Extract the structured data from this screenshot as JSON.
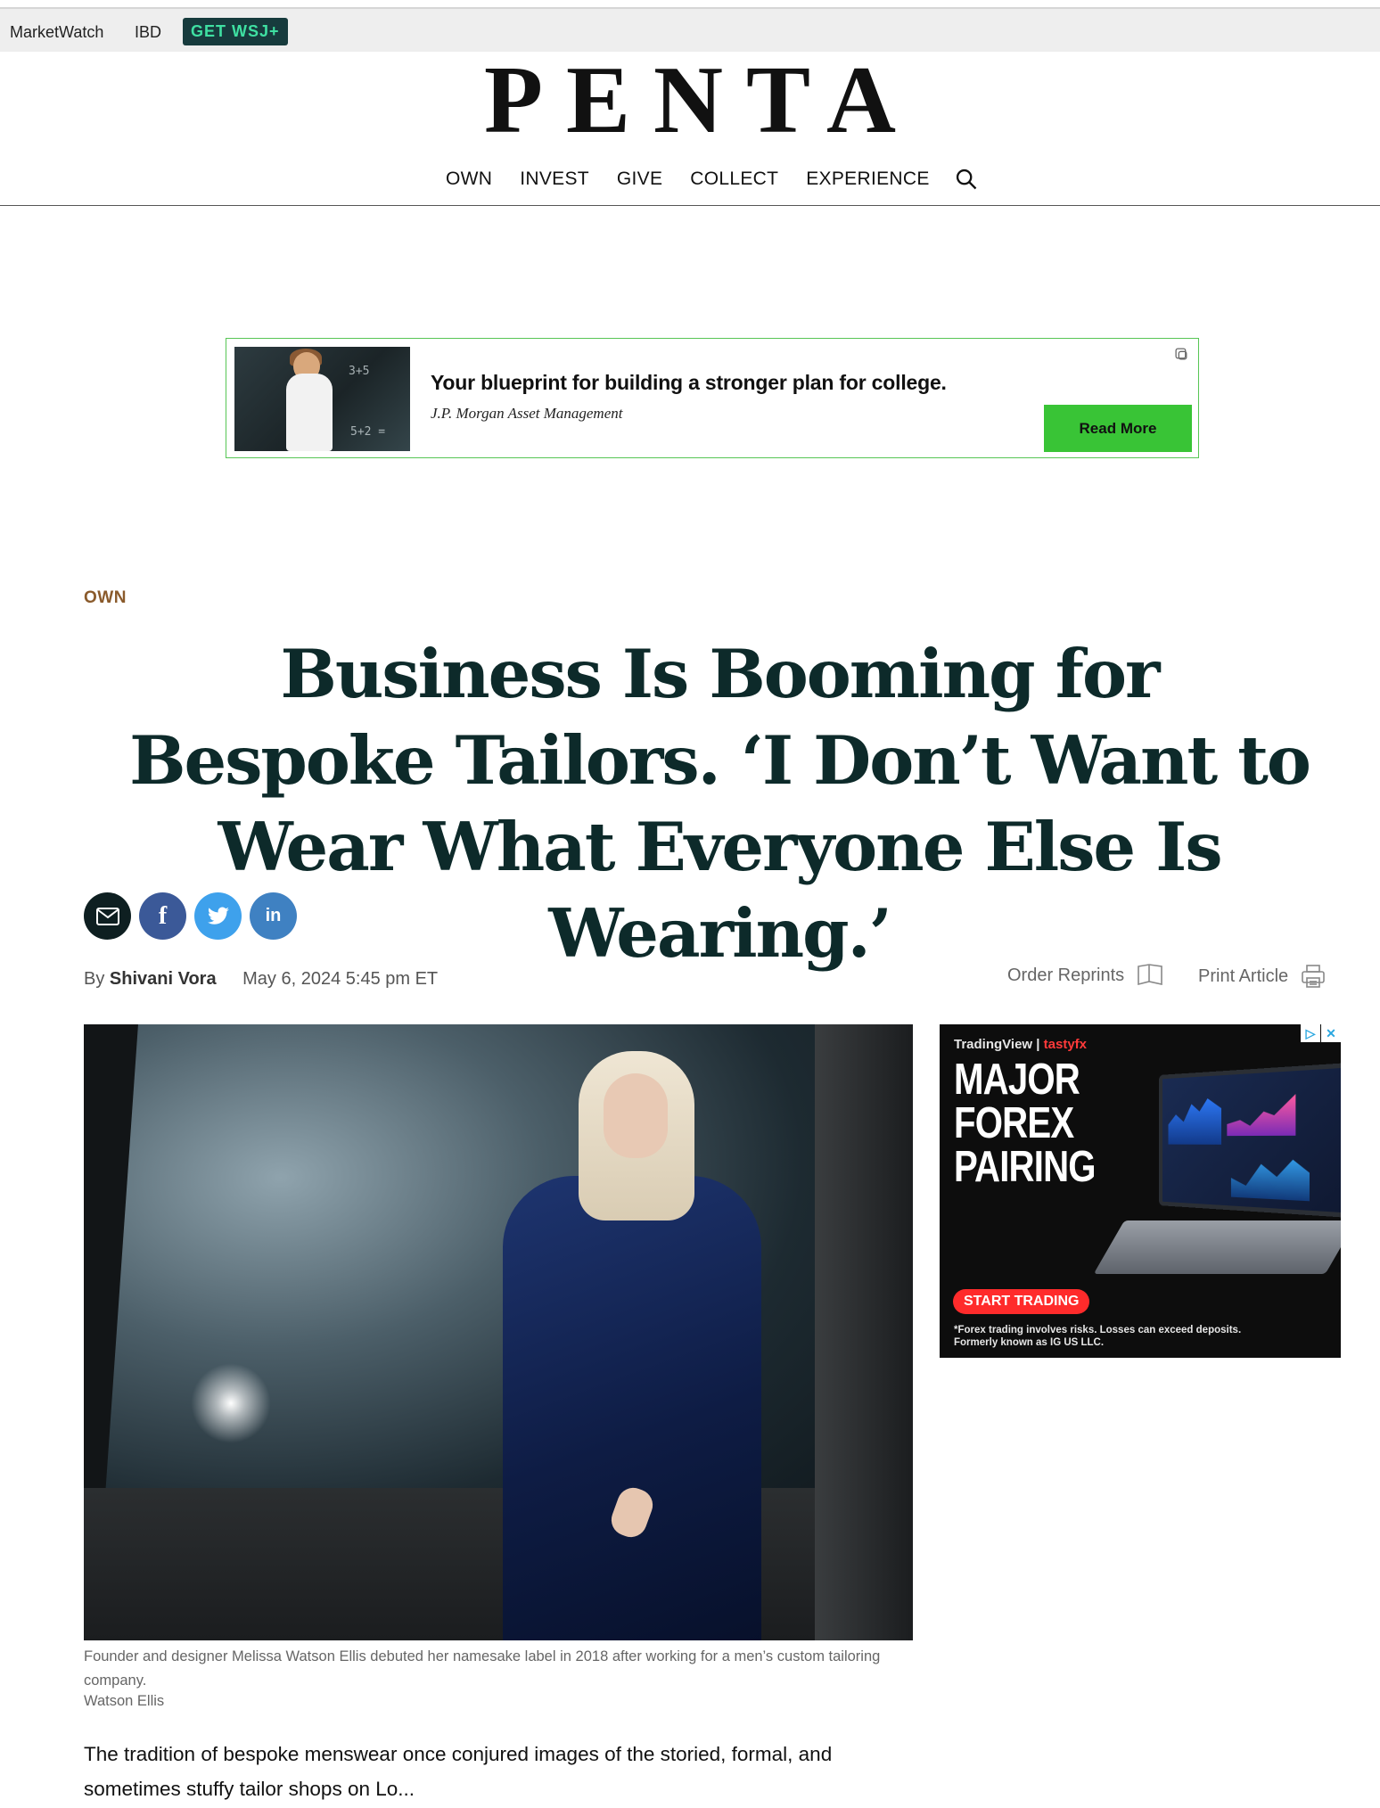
{
  "topbar": {
    "marketwatch": "MarketWatch",
    "ibd": "IBD",
    "wsj_cta": "GET WSJ+"
  },
  "masthead": {
    "logo": "PENTA",
    "nav": [
      "OWN",
      "INVEST",
      "GIVE",
      "COLLECT",
      "EXPERIENCE"
    ]
  },
  "ad_banner": {
    "title": "Your blueprint for building a stronger plan for college.",
    "sponsor": "J.P. Morgan Asset Management",
    "cta": "Read More",
    "chalk_1": "3+5",
    "chalk_2": "5+2 ="
  },
  "article": {
    "section": "OWN",
    "headline": "Business Is Booming for Bespoke Tailors. ‘I Don’t Want to Wear What Everyone Else Is Wearing.’",
    "byline_prefix": "By",
    "author": "Shivani Vora",
    "date": "May 6, 2024 5:45 pm ET",
    "order_reprints": "Order Reprints",
    "print_article": "Print Article",
    "caption": "Founder and designer Melissa Watson Ellis debuted her namesake label in 2018 after working for a men’s custom tailoring company.",
    "credit": "Watson Ellis",
    "body": "The tradition of bespoke menswear once conjured images of the storied, formal, and sometimes stuffy tailor shops on Lo..."
  },
  "share": {
    "facebook_glyph": "f",
    "linkedin_glyph": "in"
  },
  "side_ad": {
    "brand_tv": "TradingView",
    "brand_separator": "|",
    "brand_tfx": "tastyfx",
    "headline_line1": "MAJOR",
    "headline_line2": "FOREX",
    "headline_line3": "PAIRING",
    "cta": "START TRADING",
    "disclaimer_line1": "*Forex trading involves risks. Losses can exceed deposits.",
    "disclaimer_line2": "Formerly known as IG US LLC.",
    "close_glyph": "✕",
    "adchoices_glyph": "▷"
  }
}
